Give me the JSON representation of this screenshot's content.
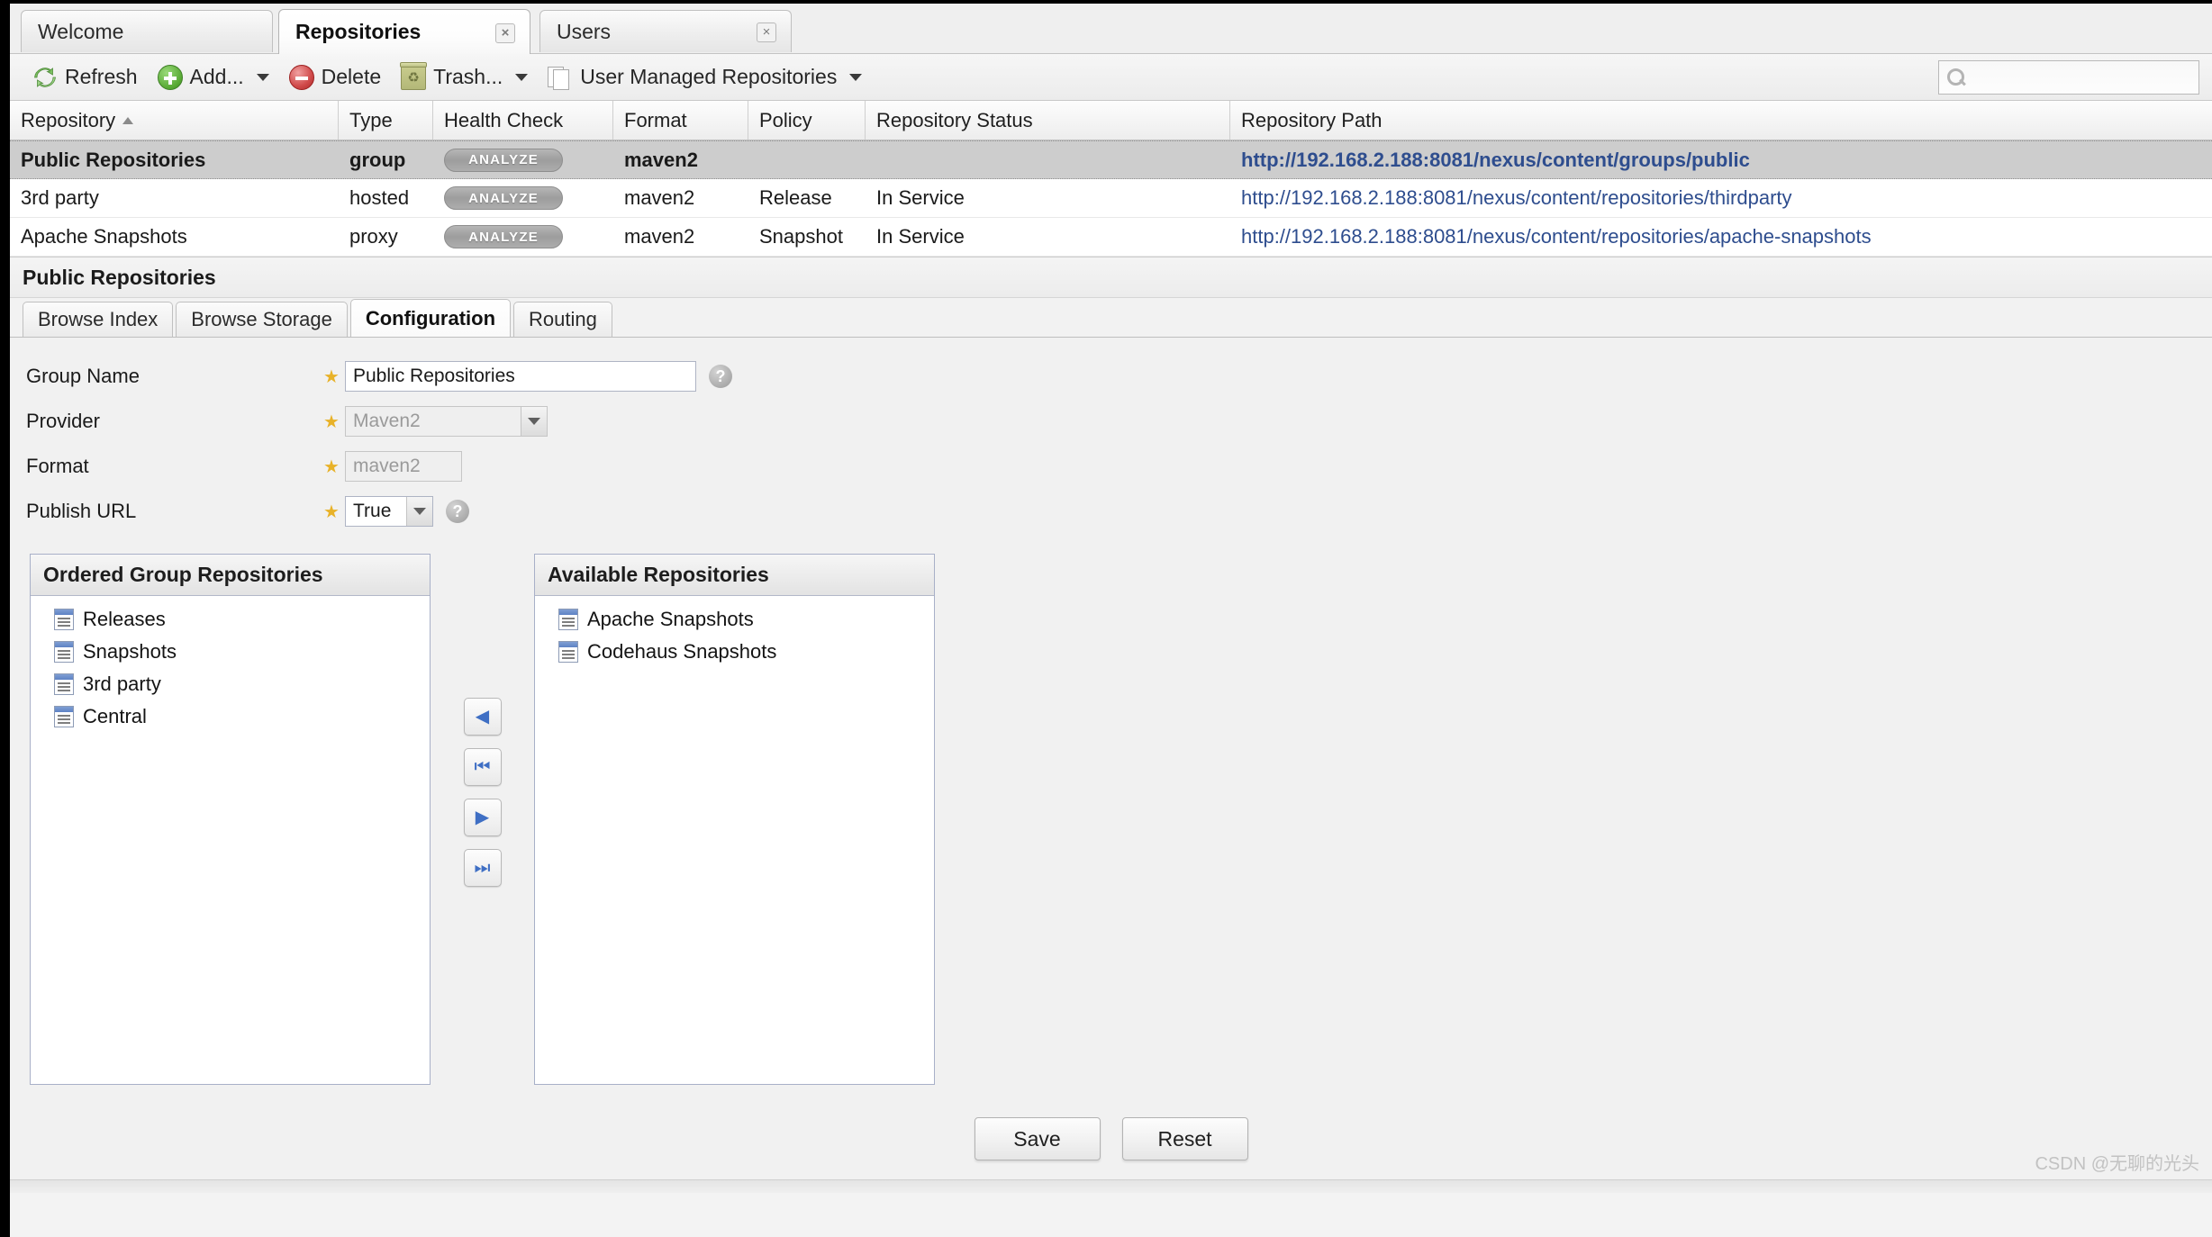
{
  "window": {
    "tabs": [
      {
        "label": "Welcome",
        "active": false,
        "closable": false
      },
      {
        "label": "Repositories",
        "active": true,
        "closable": true
      },
      {
        "label": "Users",
        "active": false,
        "closable": true
      }
    ],
    "close_glyph": "×"
  },
  "toolbar": {
    "refresh_label": "Refresh",
    "add_label": "Add...",
    "delete_label": "Delete",
    "trash_label": "Trash...",
    "user_managed_label": "User Managed Repositories",
    "search_value": "",
    "search_placeholder": ""
  },
  "grid": {
    "columns": [
      {
        "label": "Repository",
        "sorted": "asc"
      },
      {
        "label": "Type"
      },
      {
        "label": "Health Check"
      },
      {
        "label": "Format"
      },
      {
        "label": "Policy"
      },
      {
        "label": "Repository Status"
      },
      {
        "label": "Repository Path"
      }
    ],
    "analyze_label": "ANALYZE",
    "rows": [
      {
        "repository": "Public Repositories",
        "type": "group",
        "health": "ANALYZE",
        "format": "maven2",
        "policy": "",
        "status": "",
        "path": "http://192.168.2.188:8081/nexus/content/groups/public",
        "selected": true
      },
      {
        "repository": "3rd party",
        "type": "hosted",
        "health": "ANALYZE",
        "format": "maven2",
        "policy": "Release",
        "status": "In Service",
        "path": "http://192.168.2.188:8081/nexus/content/repositories/thirdparty",
        "selected": false
      },
      {
        "repository": "Apache Snapshots",
        "type": "proxy",
        "health": "ANALYZE",
        "format": "maven2",
        "policy": "Snapshot",
        "status": "In Service",
        "path": "http://192.168.2.188:8081/nexus/content/repositories/apache-snapshots",
        "selected": false
      }
    ]
  },
  "detail": {
    "title": "Public Repositories",
    "tabs": [
      {
        "label": "Browse Index",
        "active": false
      },
      {
        "label": "Browse Storage",
        "active": false
      },
      {
        "label": "Configuration",
        "active": true
      },
      {
        "label": "Routing",
        "active": false
      }
    ],
    "form": {
      "group_name_label": "Group Name",
      "group_name_value": "Public Repositories",
      "provider_label": "Provider",
      "provider_value": "Maven2",
      "format_label": "Format",
      "format_value": "maven2",
      "publish_url_label": "Publish URL",
      "publish_url_value": "True",
      "required_star": "★",
      "help_glyph": "?"
    },
    "ordered_panel": {
      "title": "Ordered Group Repositories",
      "items": [
        {
          "label": "Releases"
        },
        {
          "label": "Snapshots"
        },
        {
          "label": "3rd party"
        },
        {
          "label": "Central"
        }
      ]
    },
    "available_panel": {
      "title": "Available Repositories",
      "items": [
        {
          "label": "Apache Snapshots"
        },
        {
          "label": "Codehaus Snapshots"
        }
      ]
    },
    "transfer_buttons": [
      {
        "name": "move-left",
        "glyph": "◀"
      },
      {
        "name": "move-all-left",
        "glyph": "⏮"
      },
      {
        "name": "move-right",
        "glyph": "▶"
      },
      {
        "name": "move-all-right",
        "glyph": "⏭"
      }
    ],
    "save_label": "Save",
    "reset_label": "Reset"
  },
  "watermark": "CSDN @无聊的光头",
  "colors": {
    "link": "#2e4d8e",
    "selected_row_bg": "#cdcdcd",
    "required_star": "#e8b229",
    "panel_border": "#a8b0c8",
    "app_bg": "#f1f1f1"
  }
}
